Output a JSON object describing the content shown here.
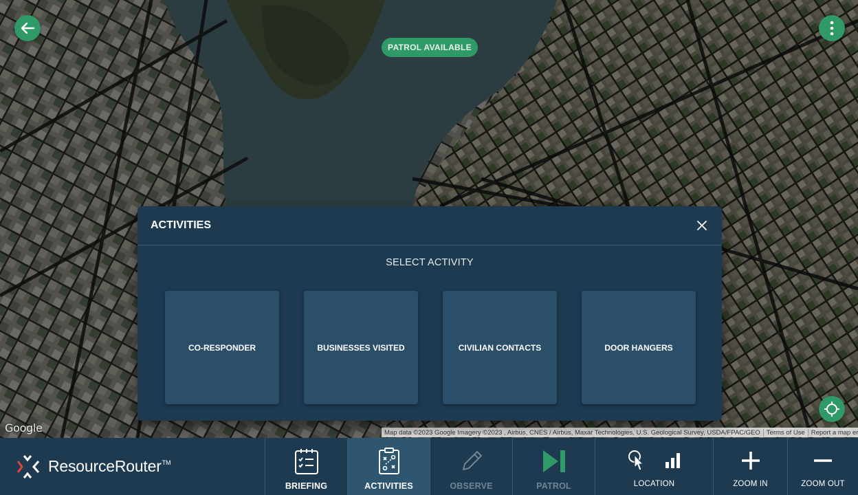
{
  "map": {
    "badge": "PATROL AVAILABLE",
    "google_logo": "Google",
    "attribution": "Map data ©2023 Google Imagery ©2023 , Airbus, CNES / Airbus, Maxar Technologies, U.S. Geological Survey, USDA/FPAC/GEO",
    "terms": "Terms of Use",
    "report": "Report a map error"
  },
  "modal": {
    "title": "ACTIVITIES",
    "subtitle": "SELECT ACTIVITY",
    "activities": [
      "CO-RESPONDER",
      "BUSINESSES VISITED",
      "CIVILIAN CONTACTS",
      "DOOR HANGERS"
    ]
  },
  "brand": {
    "name": "ResourceRouter",
    "tm": "TM"
  },
  "nav": {
    "briefing": "BRIEFING",
    "activities": "ACTIVITIES",
    "observe": "OBSERVE",
    "patrol": "PATROL"
  },
  "tools": {
    "location": "LOCATION",
    "zoom_in": "ZOOM IN",
    "zoom_out": "ZOOM OUT"
  },
  "colors": {
    "accent_green": "#2f9a67",
    "panel_navy": "#1d3a50",
    "card_blue": "#2b4f68",
    "logo_red": "#e0463a"
  },
  "icons": {
    "back": "arrow-left-icon",
    "menu": "more-vertical-icon",
    "locate": "crosshair-icon",
    "close": "close-icon",
    "briefing": "clipboard-check-icon",
    "activities": "clipboard-strategy-icon",
    "observe": "pencil-icon",
    "patrol": "skip-forward-icon",
    "location": "touch-pointer-icon",
    "signal": "signal-bars-icon",
    "zoom_in": "plus-icon",
    "zoom_out": "minus-icon"
  }
}
